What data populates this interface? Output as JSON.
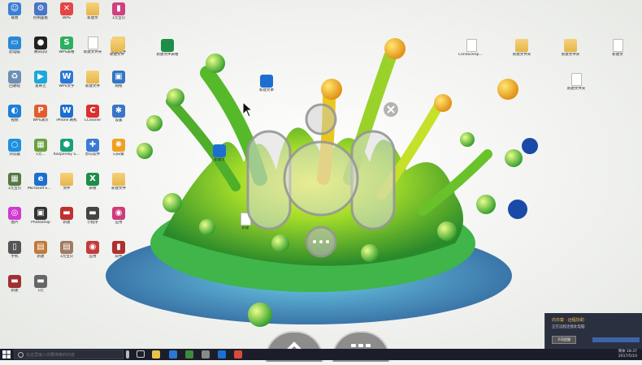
{
  "desktop_icons": [
    {
      "label": "联想",
      "type": "app",
      "color": "#3b7fd6",
      "glyph": "☺"
    },
    {
      "label": "控制面板",
      "type": "app",
      "color": "#4a74c8",
      "glyph": "⚙"
    },
    {
      "label": "WPS",
      "type": "app",
      "color": "#e54545",
      "glyph": "✕"
    },
    {
      "label": "新建文",
      "type": "folder",
      "color": "#e6b54a",
      "glyph": ""
    },
    {
      "label": "1元宝贝",
      "type": "app",
      "color": "#d04080",
      "glyph": "▮"
    },
    {
      "label": "此电脑",
      "type": "app",
      "color": "#2a88d8",
      "glyph": "▭"
    },
    {
      "label": "腾讯QQ",
      "type": "app",
      "color": "#222222",
      "glyph": "●"
    },
    {
      "label": "WPS表格",
      "type": "app",
      "color": "#2bb060",
      "glyph": "S"
    },
    {
      "label": "新建文件夹",
      "type": "doc",
      "color": "#ffffff",
      "glyph": ""
    },
    {
      "label": "新建文件",
      "type": "folder",
      "color": "#e6b54a",
      "glyph": ""
    },
    {
      "label": "回收站",
      "type": "app",
      "color": "#6c8fb5",
      "glyph": "♻"
    },
    {
      "label": "爱奇艺",
      "type": "app",
      "color": "#1ca9d8",
      "glyph": "▶"
    },
    {
      "label": "WPS文字",
      "type": "app",
      "color": "#2b78d8",
      "glyph": "W"
    },
    {
      "label": "新建文件",
      "type": "folder",
      "color": "#e6b54a",
      "glyph": ""
    },
    {
      "label": "网络",
      "type": "app",
      "color": "#3276c6",
      "glyph": "▣"
    },
    {
      "label": "视频",
      "type": "app",
      "color": "#1e7ed8",
      "glyph": "◐"
    },
    {
      "label": "WPS演示",
      "type": "app",
      "color": "#e35c2f",
      "glyph": "P"
    },
    {
      "label": "iPhone 刷机",
      "type": "word",
      "color": "#1c6fd1",
      "glyph": "W"
    },
    {
      "label": "CCleaner",
      "type": "app",
      "color": "#d93030",
      "glyph": "C"
    },
    {
      "label": "设置",
      "type": "app",
      "color": "#3975c9",
      "glyph": "✱"
    },
    {
      "label": "浏览器",
      "type": "app",
      "color": "#1d90e0",
      "glyph": "○"
    },
    {
      "label": "1元...",
      "type": "app",
      "color": "#6aa040",
      "glyph": "▦"
    },
    {
      "label": "Kaspersky Secure",
      "type": "app",
      "color": "#16a07a",
      "glyph": "⬢"
    },
    {
      "label": "办公软件",
      "type": "app",
      "color": "#3a7bd4",
      "glyph": "✚"
    },
    {
      "label": "向日葵",
      "type": "app",
      "color": "#f0a020",
      "glyph": "✺"
    },
    {
      "label": "1元宝贝",
      "type": "app",
      "color": "#557744",
      "glyph": "▦"
    },
    {
      "label": "Microsoft Edge",
      "type": "app",
      "color": "#1c6fd1",
      "glyph": "e"
    },
    {
      "label": "文件",
      "type": "folder",
      "color": "#e6b54a",
      "glyph": ""
    },
    {
      "label": "表格",
      "type": "xls",
      "color": "#1f8d4a",
      "glyph": "X"
    },
    {
      "label": "新建文件",
      "type": "folder",
      "color": "#e6b54a",
      "glyph": ""
    },
    {
      "label": "图片",
      "type": "app",
      "color": "#d03ad0",
      "glyph": "◎"
    },
    {
      "label": "Photoshop",
      "type": "app",
      "color": "#333333",
      "glyph": "▣"
    },
    {
      "label": "新建",
      "type": "app",
      "color": "#c03030",
      "glyph": "▬"
    },
    {
      "label": "小程序",
      "type": "app",
      "color": "#444444",
      "glyph": "▬"
    },
    {
      "label": "应用",
      "type": "app",
      "color": "#d03a7a",
      "glyph": "◉"
    },
    {
      "label": "手机",
      "type": "app",
      "color": "#555555",
      "glyph": "▯"
    },
    {
      "label": "新建",
      "type": "app",
      "color": "#c07a3a",
      "glyph": "▤"
    },
    {
      "label": "1元宝贝",
      "type": "app",
      "color": "#a07a60",
      "glyph": "▤"
    },
    {
      "label": "应用",
      "type": "app",
      "color": "#c83a3a",
      "glyph": "◉"
    },
    {
      "label": "软件",
      "type": "app",
      "color": "#b03030",
      "glyph": "▮"
    },
    {
      "label": "新建",
      "type": "app",
      "color": "#a03030",
      "glyph": "▬"
    },
    {
      "label": "1元",
      "type": "app",
      "color": "#666666",
      "glyph": "▬"
    }
  ],
  "extra_icons": [
    {
      "label": "新建文件表格",
      "type": "xls"
    },
    {
      "label": "新建文本",
      "type": "word"
    },
    {
      "label": "新建文件",
      "type": "folder"
    },
    {
      "label": "新建文",
      "type": "word"
    },
    {
      "label": "新建",
      "type": "doc"
    },
    {
      "label": "Conducenpo...",
      "type": "doc"
    },
    {
      "label": "新建文件夹",
      "type": "folder"
    },
    {
      "label": "新建文件夹",
      "type": "folder"
    },
    {
      "label": "新建文",
      "type": "doc"
    },
    {
      "label": "新建文件夹",
      "type": "doc"
    }
  ],
  "taskbar": {
    "search_placeholder": "在这里输入你要搜索的内容",
    "lang": "简体",
    "time": "18:37",
    "date": "2017/5/10"
  },
  "notification": {
    "title": "向日葵 · 远程协助",
    "body": "正在远程连接此电脑",
    "button": "不再提醒"
  },
  "colors": {
    "taskbar": "#1b1e2a",
    "accent": "#3d64a8"
  }
}
